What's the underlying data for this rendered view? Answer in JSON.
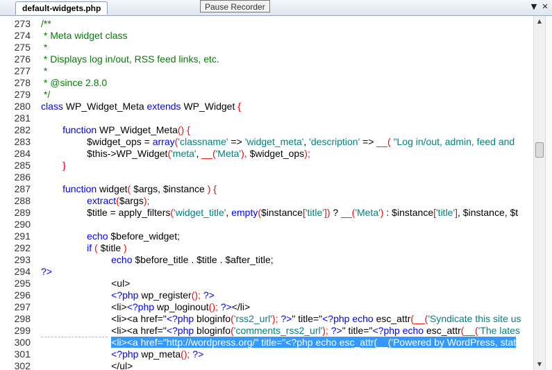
{
  "tab": {
    "filename": "default-widgets.php"
  },
  "tooltip": {
    "text": "Pause Recorder"
  },
  "tab_controls": {
    "dropdown_icon": "chevron-down-icon",
    "close_icon": "close-icon"
  },
  "selected_line": "300",
  "lines": [
    {
      "n": "273",
      "segs": [
        {
          "t": "/**",
          "c": "c"
        }
      ]
    },
    {
      "n": "274",
      "segs": [
        {
          "t": " * Meta widget class",
          "c": "c"
        }
      ]
    },
    {
      "n": "275",
      "segs": [
        {
          "t": " *",
          "c": "c"
        }
      ]
    },
    {
      "n": "276",
      "segs": [
        {
          "t": " * Displays log in/out, RSS feed links, etc.",
          "c": "c"
        }
      ]
    },
    {
      "n": "277",
      "segs": [
        {
          "t": " *",
          "c": "c"
        }
      ]
    },
    {
      "n": "278",
      "segs": [
        {
          "t": " * @since 2.8.0",
          "c": "c"
        }
      ]
    },
    {
      "n": "279",
      "segs": [
        {
          "t": " */",
          "c": "c"
        }
      ]
    },
    {
      "n": "280",
      "segs": [
        {
          "t": "class",
          "c": "k"
        },
        {
          "t": " WP_Widget_Meta ",
          "c": ""
        },
        {
          "t": "extends",
          "c": "k"
        },
        {
          "t": " WP_Widget ",
          "c": ""
        },
        {
          "t": "{",
          "c": "p"
        }
      ]
    },
    {
      "n": "281",
      "segs": []
    },
    {
      "n": "282",
      "segs": [
        {
          "t": "        ",
          "c": ""
        },
        {
          "t": "function",
          "c": "k"
        },
        {
          "t": " WP_Widget_Meta",
          "c": ""
        },
        {
          "t": "() {",
          "c": "p"
        }
      ]
    },
    {
      "n": "283",
      "segs": [
        {
          "t": "                 $widget_ops = ",
          "c": ""
        },
        {
          "t": "array",
          "c": "k"
        },
        {
          "t": "(",
          "c": "p"
        },
        {
          "t": "'classname'",
          "c": "s"
        },
        {
          "t": " => ",
          "c": ""
        },
        {
          "t": "'widget_meta'",
          "c": "s"
        },
        {
          "t": ", ",
          "c": ""
        },
        {
          "t": "'description'",
          "c": "s"
        },
        {
          "t": " => ",
          "c": ""
        },
        {
          "t": "__(",
          "c": "p"
        },
        {
          "t": " \"Log in/out, admin, feed and",
          "c": "s"
        }
      ]
    },
    {
      "n": "284",
      "segs": [
        {
          "t": "                 $this->WP_Widget",
          "c": ""
        },
        {
          "t": "(",
          "c": "p"
        },
        {
          "t": "'meta'",
          "c": "s"
        },
        {
          "t": ", ",
          "c": ""
        },
        {
          "t": "__(",
          "c": "p"
        },
        {
          "t": "'Meta'",
          "c": "s"
        },
        {
          "t": "), ",
          "c": "p"
        },
        {
          "t": "$widget_ops",
          "c": ""
        },
        {
          "t": ");",
          "c": "p"
        }
      ]
    },
    {
      "n": "285",
      "segs": [
        {
          "t": "        ",
          "c": ""
        },
        {
          "t": "}",
          "c": "p"
        }
      ]
    },
    {
      "n": "286",
      "segs": []
    },
    {
      "n": "287",
      "segs": [
        {
          "t": "        ",
          "c": ""
        },
        {
          "t": "function",
          "c": "k"
        },
        {
          "t": " widget",
          "c": ""
        },
        {
          "t": "( ",
          "c": "p"
        },
        {
          "t": "$args, $instance ",
          "c": ""
        },
        {
          "t": ") {",
          "c": "p"
        }
      ]
    },
    {
      "n": "288",
      "segs": [
        {
          "t": "                 ",
          "c": ""
        },
        {
          "t": "extract",
          "c": "k"
        },
        {
          "t": "(",
          "c": "p"
        },
        {
          "t": "$args",
          "c": ""
        },
        {
          "t": ");",
          "c": "p"
        }
      ]
    },
    {
      "n": "289",
      "segs": [
        {
          "t": "                 $title = apply_filters",
          "c": ""
        },
        {
          "t": "(",
          "c": "p"
        },
        {
          "t": "'widget_title'",
          "c": "s"
        },
        {
          "t": ", ",
          "c": ""
        },
        {
          "t": "empty",
          "c": "k"
        },
        {
          "t": "(",
          "c": "p"
        },
        {
          "t": "$instance",
          "c": ""
        },
        {
          "t": "[",
          "c": "p"
        },
        {
          "t": "'title'",
          "c": "s"
        },
        {
          "t": "]) ",
          "c": "p"
        },
        {
          "t": "? ",
          "c": ""
        },
        {
          "t": "__(",
          "c": "p"
        },
        {
          "t": "'Meta'",
          "c": "s"
        },
        {
          "t": ") ",
          "c": "p"
        },
        {
          "t": ": $instance",
          "c": ""
        },
        {
          "t": "[",
          "c": "p"
        },
        {
          "t": "'title'",
          "c": "s"
        },
        {
          "t": "]",
          "c": "p"
        },
        {
          "t": ", $instance, $t",
          "c": ""
        }
      ]
    },
    {
      "n": "290",
      "segs": []
    },
    {
      "n": "291",
      "segs": [
        {
          "t": "                 ",
          "c": ""
        },
        {
          "t": "echo",
          "c": "k"
        },
        {
          "t": " $before_widget;",
          "c": ""
        }
      ]
    },
    {
      "n": "292",
      "segs": [
        {
          "t": "                 ",
          "c": ""
        },
        {
          "t": "if",
          "c": "k"
        },
        {
          "t": " ( ",
          "c": "p"
        },
        {
          "t": "$title ",
          "c": ""
        },
        {
          "t": ")",
          "c": "p"
        }
      ]
    },
    {
      "n": "293",
      "segs": [
        {
          "t": "                          ",
          "c": ""
        },
        {
          "t": "echo",
          "c": "k"
        },
        {
          "t": " $before_title . $title . $after_title;",
          "c": ""
        }
      ]
    },
    {
      "n": "294",
      "segs": [
        {
          "t": "?>",
          "c": "k"
        }
      ]
    },
    {
      "n": "295",
      "segs": [
        {
          "t": "                          <ul>",
          "c": ""
        }
      ]
    },
    {
      "n": "296",
      "segs": [
        {
          "t": "                          ",
          "c": ""
        },
        {
          "t": "<?php",
          "c": "k"
        },
        {
          "t": " wp_register",
          "c": ""
        },
        {
          "t": "(); ",
          "c": "p"
        },
        {
          "t": "?>",
          "c": "k"
        }
      ]
    },
    {
      "n": "297",
      "segs": [
        {
          "t": "                          <li>",
          "c": ""
        },
        {
          "t": "<?php",
          "c": "k"
        },
        {
          "t": " wp_loginout",
          "c": ""
        },
        {
          "t": "(); ",
          "c": "p"
        },
        {
          "t": "?>",
          "c": "k"
        },
        {
          "t": "</li>",
          "c": ""
        }
      ]
    },
    {
      "n": "298",
      "segs": [
        {
          "t": "                          <li><a href=\"",
          "c": ""
        },
        {
          "t": "<?php",
          "c": "k"
        },
        {
          "t": " bloginfo",
          "c": ""
        },
        {
          "t": "(",
          "c": "p"
        },
        {
          "t": "'rss2_url'",
          "c": "s"
        },
        {
          "t": "); ",
          "c": "p"
        },
        {
          "t": "?>",
          "c": "k"
        },
        {
          "t": "\" title=\"",
          "c": ""
        },
        {
          "t": "<?php",
          "c": "k"
        },
        {
          "t": " echo",
          "c": "k"
        },
        {
          "t": " esc_attr",
          "c": ""
        },
        {
          "t": "(__(",
          "c": "p"
        },
        {
          "t": "'Syndicate this site us",
          "c": "s"
        }
      ]
    },
    {
      "n": "299",
      "segs": [
        {
          "t": "                          <li><a href=\"",
          "c": ""
        },
        {
          "t": "<?php",
          "c": "k"
        },
        {
          "t": " bloginfo",
          "c": ""
        },
        {
          "t": "(",
          "c": "p"
        },
        {
          "t": "'comments_rss2_url'",
          "c": "s"
        },
        {
          "t": "); ",
          "c": "p"
        },
        {
          "t": "?>",
          "c": "k"
        },
        {
          "t": "\" title=\"",
          "c": ""
        },
        {
          "t": "<?php",
          "c": "k"
        },
        {
          "t": " echo",
          "c": "k"
        },
        {
          "t": " esc_attr",
          "c": ""
        },
        {
          "t": "(__(",
          "c": "p"
        },
        {
          "t": "'The lates",
          "c": "s"
        }
      ]
    },
    {
      "n": "300",
      "segs": [
        {
          "t": "                          ",
          "c": ""
        },
        {
          "t": "<li><a href=\"http://wordpress.org/\" title=\"<?php echo esc_attr(__('Powered by WordPress, stat",
          "c": "w"
        }
      ]
    },
    {
      "n": "301",
      "segs": [
        {
          "t": "                          ",
          "c": ""
        },
        {
          "t": "<?php",
          "c": "k"
        },
        {
          "t": " wp_meta",
          "c": ""
        },
        {
          "t": "(); ",
          "c": "p"
        },
        {
          "t": "?>",
          "c": "k"
        }
      ]
    },
    {
      "n": "302",
      "segs": [
        {
          "t": "                          </ul>",
          "c": ""
        }
      ]
    }
  ]
}
